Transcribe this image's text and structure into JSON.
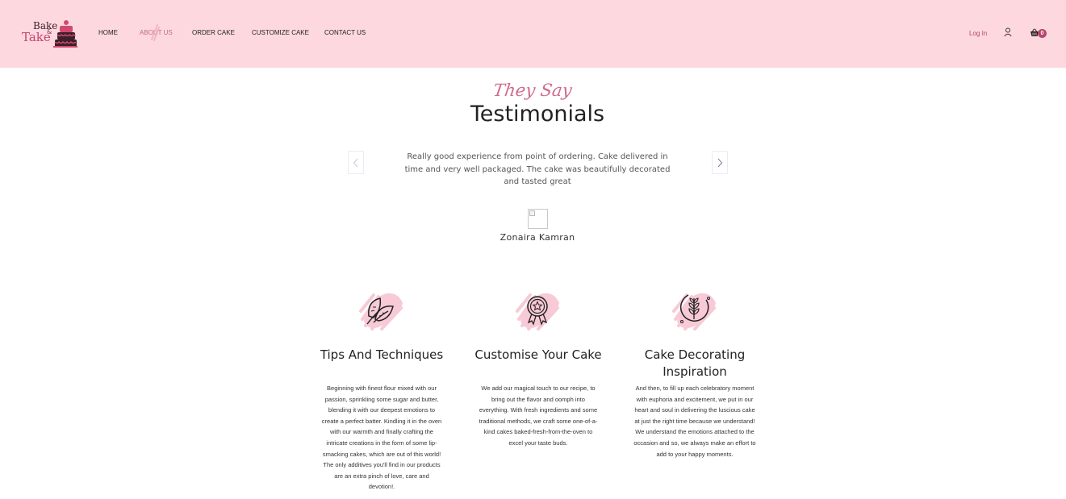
{
  "header": {
    "logo": {
      "line1": "Bake",
      "amp": "&",
      "line2": "Take"
    },
    "nav": [
      {
        "label": "HOME",
        "active": false
      },
      {
        "label": "ABOUT US",
        "active": true
      },
      {
        "label": "ORDER CAKE",
        "active": false
      },
      {
        "label": "CUSTOMIZE CAKE",
        "active": false
      },
      {
        "label": "CONTACT US",
        "active": false
      }
    ],
    "login_label": "Log In",
    "user_icon": "user-icon",
    "cart_icon": "basket-icon",
    "cart_count": "0"
  },
  "testimonials": {
    "script_title": "They Say",
    "title": "Testimonials",
    "quote": "Really good experience from point of ordering. Cake delivered in time and very well packaged. The cake was beautifully decorated and tasted great",
    "reviewer": "Zonaira Kamran",
    "prev_icon": "chevron-left-icon",
    "next_icon": "chevron-right-icon"
  },
  "features": [
    {
      "icon": "leaf-icon",
      "title": "Tips And Techniques",
      "body": "Beginning with finest flour mixed with our passion, sprinkling some sugar and butter, blending it with our deepest emotions to create a perfect batter. Kindling it in the oven with our warmth and finally crafting the intricate creations in the form of some lip-smacking cakes, which are out of this world! The only additives you'll find in our products are an extra pinch of love, care and devotion!."
    },
    {
      "icon": "award-icon",
      "title": "Customise Your Cake",
      "body": "We add our magical touch to our recipe, to bring out the flavor and oomph into everything. With fresh ingredients and some traditional methods, we craft some one-of-a-kind cakes baked-fresh-from-the-oven to excel your taste buds."
    },
    {
      "icon": "wheat-icon",
      "title": "Cake Decorating Inspiration",
      "body": "And then, to fill up each celebratory moment with euphoria and excitement, we put in our heart and soul in delivering the luscious cake at just the right time because we understand! We understand the emotions attached to the occasion and so, we always make an effort to add to your happy moments."
    }
  ],
  "colors": {
    "header_bg": "#fdd8de",
    "accent": "#b8456e",
    "brush": "#f8c9d6"
  }
}
